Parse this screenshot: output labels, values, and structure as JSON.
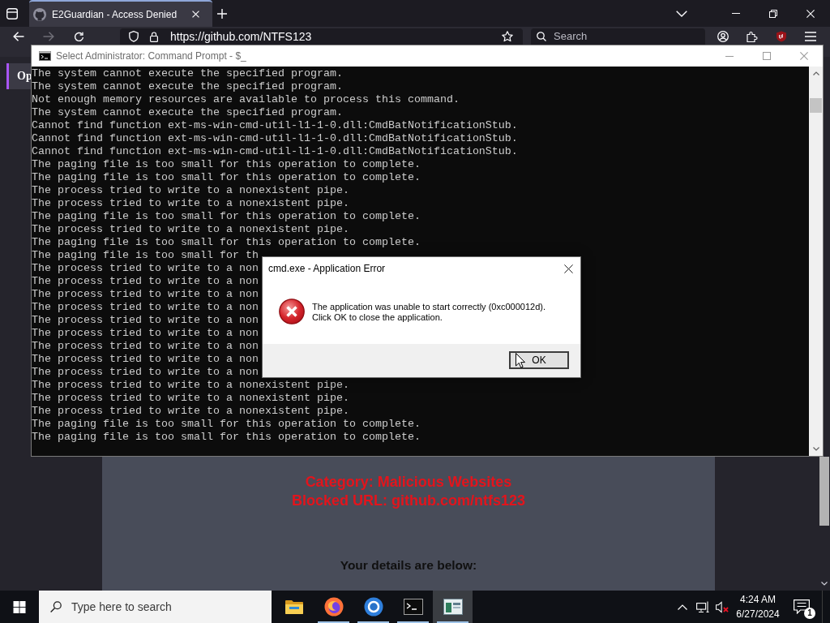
{
  "browser": {
    "tabs": [
      {
        "title": "E2Guardian - Access Denied",
        "selected": true
      }
    ],
    "nav_buttons": [
      {
        "kind": "back",
        "disabled": false
      },
      {
        "kind": "forward",
        "disabled": true
      },
      {
        "kind": "reload",
        "disabled": false
      }
    ],
    "url": "https://github.com/NTFS123",
    "search": {
      "placeholder": "Search"
    },
    "page": {
      "side_button": "Op",
      "category": "Category: Malicious Websites",
      "blocked_url": "Blocked URL: github.com/ntfs123",
      "details_heading": "Your details are below:"
    }
  },
  "console_window": {
    "title": "Select Administrator: Command Prompt - $_",
    "lines": [
      "The system cannot execute the specified program.",
      "The system cannot execute the specified program.",
      "Not enough memory resources are available to process this command.",
      "The system cannot execute the specified program.",
      "Cannot find function ext-ms-win-cmd-util-l1-1-0.dll:CmdBatNotificationStub.",
      "Cannot find function ext-ms-win-cmd-util-l1-1-0.dll:CmdBatNotificationStub.",
      "Cannot find function ext-ms-win-cmd-util-l1-1-0.dll:CmdBatNotificationStub.",
      "The paging file is too small for this operation to complete.",
      "The paging file is too small for this operation to complete.",
      "The process tried to write to a nonexistent pipe.",
      "The process tried to write to a nonexistent pipe.",
      "The paging file is too small for this operation to complete.",
      "The process tried to write to a nonexistent pipe.",
      "The paging file is too small for this operation to complete.",
      "The paging file is too small for th",
      "The process tried to write to a non",
      "The process tried to write to a non",
      "The process tried to write to a non",
      "The process tried to write to a non",
      "The process tried to write to a non",
      "The process tried to write to a non",
      "The process tried to write to a non",
      "The process tried to write to a non",
      "The process tried to write to a non",
      "The process tried to write to a nonexistent pipe.",
      "The process tried to write to a nonexistent pipe.",
      "The process tried to write to a nonexistent pipe.",
      "The paging file is too small for this operation to complete.",
      "The paging file is too small for this operation to complete."
    ]
  },
  "error_dialog": {
    "title": "cmd.exe - Application Error",
    "message": "The application was unable to start correctly (0xc000012d).\nClick OK to close the application.",
    "buttons": [
      "OK"
    ]
  },
  "taskbar": {
    "search": {
      "placeholder": "Type here to search"
    },
    "apps": [
      {
        "kind": "files",
        "running": false,
        "active": false
      },
      {
        "kind": "fox",
        "running": true,
        "active": false
      },
      {
        "kind": "ring",
        "running": true,
        "active": false
      },
      {
        "kind": "terminal",
        "running": true,
        "active": false
      },
      {
        "kind": "viewer",
        "running": true,
        "active": true
      }
    ],
    "volume": {
      "muted": true
    },
    "clock": {
      "time": "4:24 AM",
      "date": "6/27/2024"
    },
    "notifications": {
      "count": "1"
    }
  }
}
